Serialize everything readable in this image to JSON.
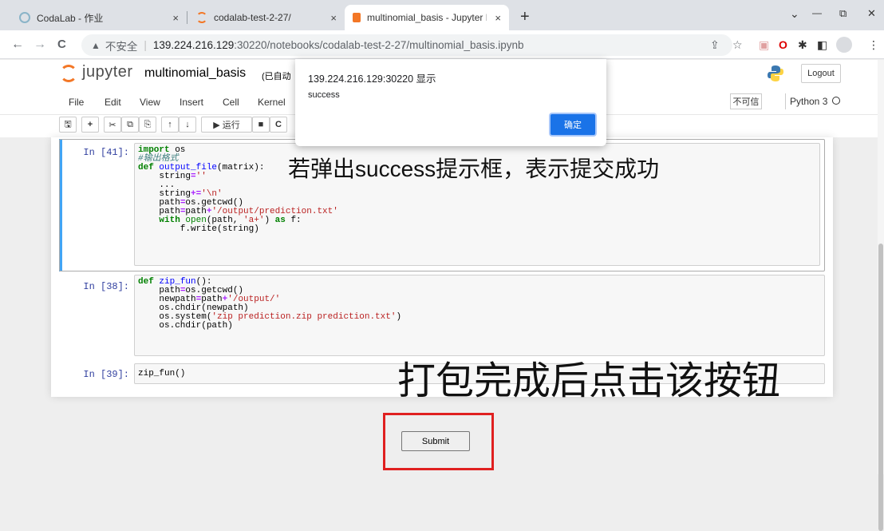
{
  "browser": {
    "tabs": [
      {
        "title": "CodaLab - 作业",
        "close": "×"
      },
      {
        "title": "codalab-test-2-27/",
        "close": "×"
      },
      {
        "title": "multinomial_basis - Jupyter N",
        "close": "×"
      }
    ],
    "new_tab": "+",
    "window_controls": {
      "minimize": "—",
      "restore": "⧉",
      "close": "✕",
      "dropdown": "⌄"
    },
    "nav": {
      "back": "←",
      "forward": "→",
      "reload": "C"
    },
    "address": {
      "warning_icon": "▲",
      "insecure_label": "不安全",
      "separator": "|",
      "host": "139.224.216.129",
      "rest": ":30220/notebooks/codalab-test-2-27/multinomial_basis.ipynb"
    }
  },
  "jupyter": {
    "logo_text": "jupyter",
    "notebook_name": "multinomial_basis",
    "autosave_status": "(已自动",
    "logout_label": "Logout",
    "menu": [
      "File",
      "Edit",
      "View",
      "Insert",
      "Cell",
      "Kernel"
    ],
    "trusted_badge": "不可信",
    "kernel_name": "Python 3",
    "run_label": "运行",
    "cells": [
      {
        "prompt": "In  [41]:",
        "lines": [
          "import os",
          "#输出格式",
          "def output_file(matrix):",
          "    string=''",
          "    ...",
          "    string+='\\n'",
          "    path=os.getcwd()",
          "    path=path+'/output/prediction.txt'",
          "    with open(path, 'a+') as f:",
          "        f.write(string)"
        ]
      },
      {
        "prompt": "In  [38]:",
        "lines": [
          "def zip_fun():",
          "    path=os.getcwd()",
          "    newpath=path+'/output/'",
          "    os.chdir(newpath)",
          "    os.system('zip prediction.zip prediction.txt')",
          "    os.chdir(path)"
        ]
      },
      {
        "prompt": "In  [39]:",
        "lines": [
          "zip_fun()"
        ]
      }
    ],
    "submit_label": "Submit"
  },
  "dialog": {
    "title": "139.224.216.129:30220 显示",
    "message": "success",
    "ok_label": "确定"
  },
  "annotations": {
    "popup_note": "若弹出success提示框，表示提交成功",
    "button_note": "打包完成后点击该按钮"
  },
  "colors": {
    "accent_blue": "#1a73e8",
    "highlight_red": "#e02020",
    "selected_cell_bar": "#42a5f5"
  }
}
